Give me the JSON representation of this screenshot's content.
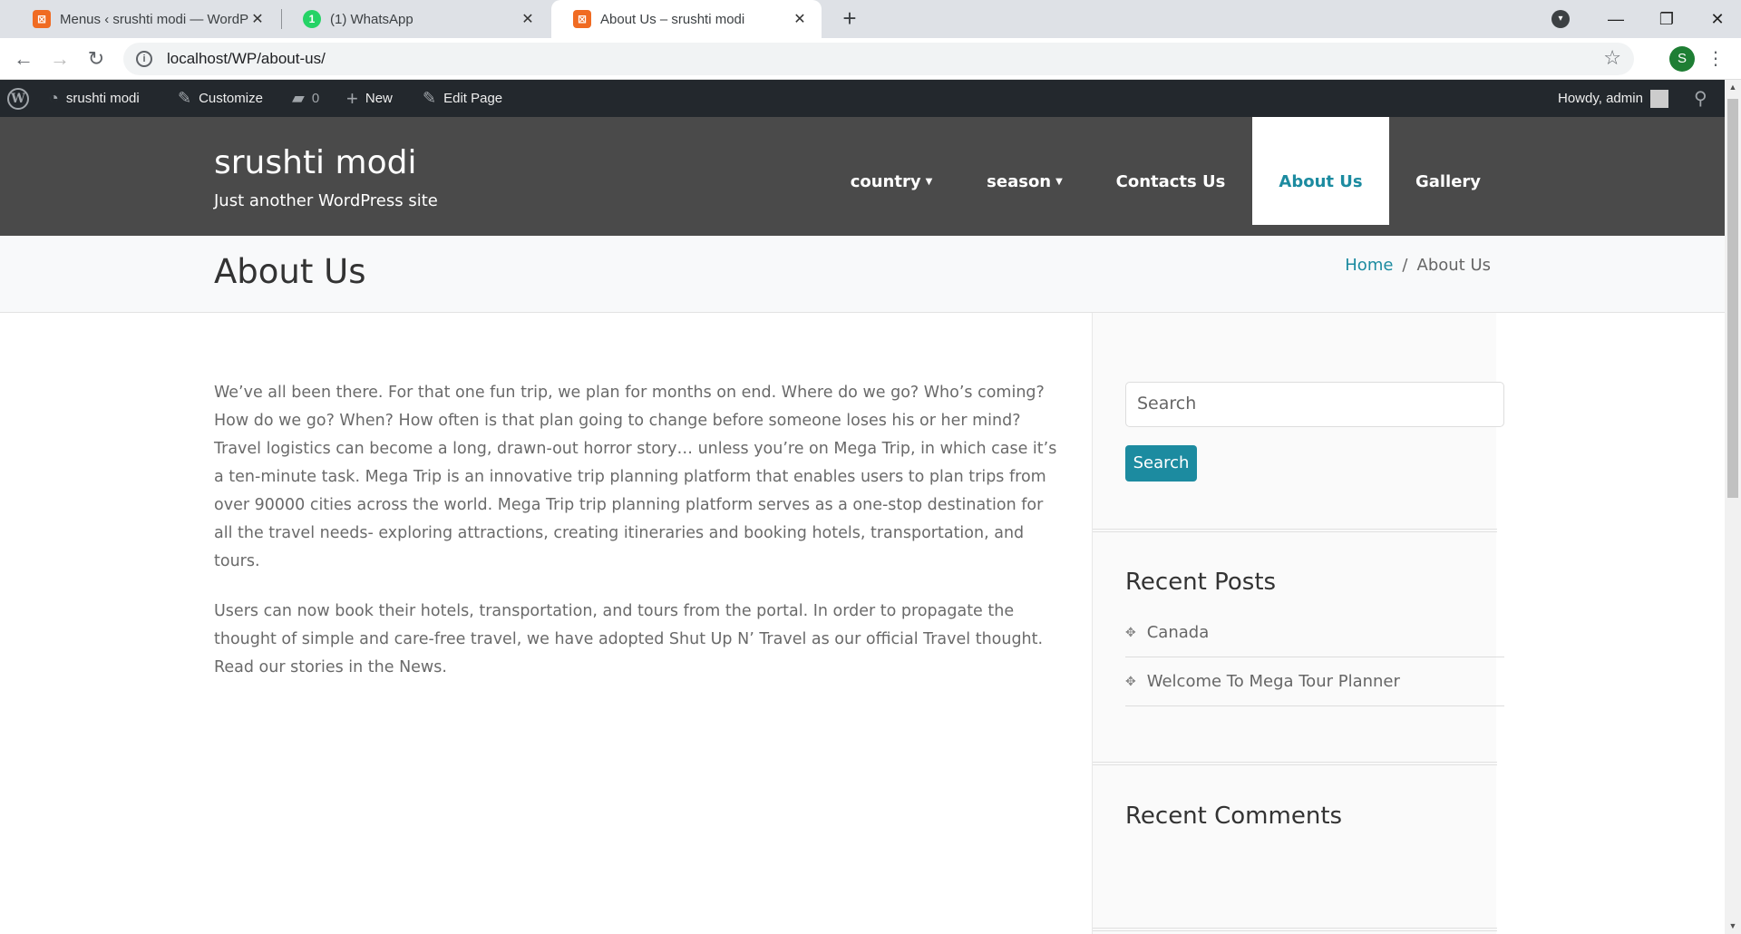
{
  "browser": {
    "tabs": [
      {
        "title": "Menus ‹ srushti modi — WordPre",
        "favicon": "xampp-icon",
        "active": false
      },
      {
        "title": "(1) WhatsApp",
        "favicon": "whatsapp-icon",
        "badge": "1",
        "active": false
      },
      {
        "title": "About Us – srushti modi",
        "favicon": "xampp-icon",
        "active": true
      }
    ],
    "url": "localhost/WP/about-us/",
    "profile_initial": "S"
  },
  "adminbar": {
    "site_name": "srushti modi",
    "customize": "Customize",
    "comments_count": "0",
    "new": "New",
    "edit_page": "Edit Page",
    "howdy": "Howdy, admin"
  },
  "site": {
    "title": "srushti modi",
    "tagline": "Just another WordPress site"
  },
  "menu": {
    "items": [
      {
        "label": "country",
        "dropdown": true
      },
      {
        "label": "season",
        "dropdown": true
      },
      {
        "label": "Contacts Us",
        "dropdown": false
      },
      {
        "label": "About Us",
        "dropdown": false,
        "current": true
      },
      {
        "label": "Gallery",
        "dropdown": false
      }
    ]
  },
  "page": {
    "title": "About Us",
    "breadcrumb": {
      "home": "Home",
      "separator": "/",
      "current": "About Us"
    },
    "paragraphs": [
      "We’ve all been there. For that one fun trip, we plan for months on end. Where do we go? Who’s coming? How do we go? When? How often is that plan going to change before someone loses his or her mind? Travel logistics can become a long, drawn-out horror story… unless you’re on Mega Trip, in which case it’s a ten-minute task. Mega Trip is an innovative trip planning platform that enables users to plan trips from over 90000 cities across the world. Mega Trip trip planning platform serves as a one-stop destination for all the travel needs- exploring attractions, creating itineraries and booking hotels, transportation, and tours.",
      "Users can now book their hotels, transportation, and tours from the portal. In order to propagate the thought of simple and care-free travel, we have adopted Shut Up N’ Travel as our official Travel thought. Read our stories in the News."
    ]
  },
  "sidebar": {
    "search_placeholder": "Search",
    "search_button": "Search",
    "recent_posts_title": "Recent Posts",
    "recent_posts": [
      "Canada",
      "Welcome To Mega Tour Planner"
    ],
    "recent_comments_title": "Recent Comments"
  },
  "colors": {
    "accent": "#1c8ba0",
    "header_bg": "#4a4a4a",
    "adminbar_bg": "#23282d"
  }
}
